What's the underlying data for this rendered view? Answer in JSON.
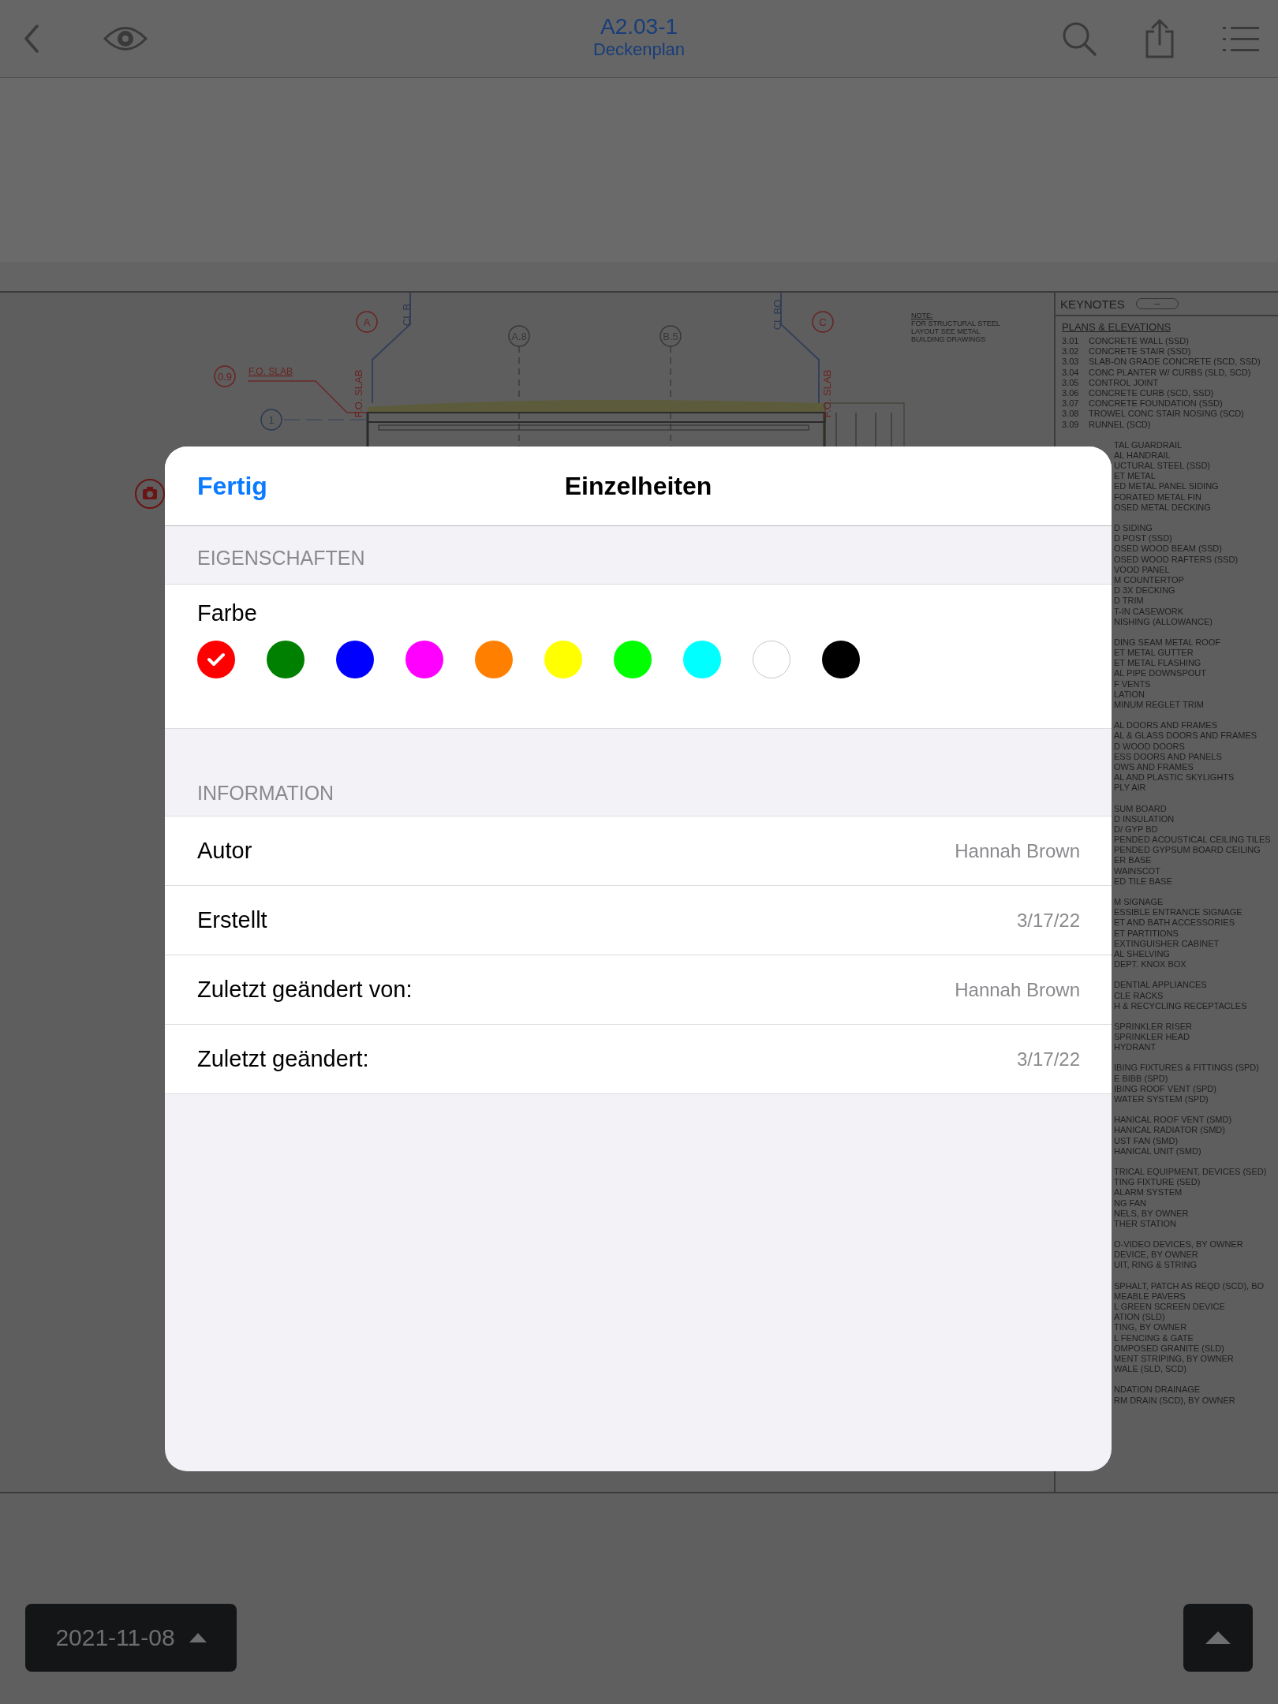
{
  "nav": {
    "title": "A2.03-1",
    "subtitle": "Deckenplan"
  },
  "drawing": {
    "bubbles": [
      "A",
      "A.8",
      "B.5",
      "C",
      "0.9",
      "1"
    ],
    "vertical_labels": [
      "CL B",
      "CL BO",
      "F.O. SLAB",
      "F.O. SLAB"
    ],
    "slab_label": "F.O. SLAB",
    "note": [
      "NOTE:",
      "FOR STRUCTURAL STEEL",
      "LAYOUT SEE METAL",
      "BUILDING DRAWINGS"
    ]
  },
  "keynotes": {
    "title": "KEYNOTES",
    "section": "PLANS & ELEVATIONS",
    "items": [
      {
        "number": "3.01",
        "text": "CONCRETE WALL (SSD)"
      },
      {
        "number": "3.02",
        "text": "CONCRETE STAIR (SSD)"
      },
      {
        "number": "3.03",
        "text": "SLAB-ON GRADE CONCRETE (SCD, SSD)"
      },
      {
        "number": "3.04",
        "text": "CONC PLANTER W/ CURBS (SLD, SCD)"
      },
      {
        "number": "3.05",
        "text": "CONTROL JOINT"
      },
      {
        "number": "3.06",
        "text": "CONCRETE CURB (SCD, SSD)"
      },
      {
        "number": "3.07",
        "text": "CONCRETE FOUNDATION (SSD)"
      },
      {
        "number": "3.08",
        "text": "TROWEL CONC STAIR NOSING (SCD)"
      },
      {
        "number": "3.09",
        "text": "RUNNEL (SCD)"
      }
    ],
    "covered_groups": [
      [
        "TAL GUARDRAIL",
        "AL HANDRAIL",
        "UCTURAL STEEL (SSD)",
        "ET METAL",
        "ED METAL PANEL SIDING",
        "FORATED METAL FIN",
        "OSED METAL DECKING"
      ],
      [
        "D SIDING",
        "D POST (SSD)",
        "OSED WOOD BEAM (SSD)",
        "OSED WOOD RAFTERS (SSD)",
        "VOOD PANEL",
        "M COUNTERTOP",
        "D 3X DECKING",
        "D TRIM",
        "T-IN CASEWORK",
        "NISHING (ALLOWANCE)"
      ],
      [
        "DING SEAM METAL ROOF",
        "ET METAL GUTTER",
        "ET METAL FLASHING",
        "AL PIPE DOWNSPOUT",
        "F VENTS",
        "LATION",
        "MINUM REGLET TRIM"
      ],
      [
        "AL DOORS AND FRAMES",
        "AL & GLASS DOORS AND FRAMES",
        "D WOOD DOORS",
        "ESS DOORS AND PANELS",
        "OWS AND FRAMES",
        "AL AND PLASTIC SKYLIGHTS",
        "PLY AIR"
      ],
      [
        "SUM BOARD",
        "D INSULATION",
        "D/ GYP BD",
        "PENDED ACOUSTICAL CEILING TILES",
        "PENDED GYPSUM BOARD CEILING",
        "ER BASE",
        "WAINSCOT",
        "ED TILE BASE"
      ],
      [
        "M SIGNAGE",
        "ESSIBLE ENTRANCE SIGNAGE",
        "ET AND BATH ACCESSORIES",
        "ET PARTITIONS",
        "EXTINGUISHER CABINET",
        "AL SHELVING",
        "DEPT. KNOX BOX"
      ],
      [
        "DENTIAL APPLIANCES",
        "CLE RACKS",
        "H & RECYCLING RECEPTACLES"
      ],
      [
        "SPRINKLER RISER",
        "SPRINKLER HEAD",
        "HYDRANT"
      ],
      [
        "IBING FIXTURES & FITTINGS (SPD)",
        "E BIBB (SPD)",
        "IBING ROOF VENT (SPD)",
        "WATER SYSTEM (SPD)"
      ],
      [
        "HANICAL ROOF VENT (SMD)",
        "HANICAL RADIATOR (SMD)",
        "UST FAN (SMD)",
        "HANICAL UNIT (SMD)"
      ],
      [
        "TRICAL EQUIPMENT, DEVICES (SED)",
        "TING FIXTURE (SED)",
        "ALARM SYSTEM",
        "NG FAN",
        "NELS, BY OWNER",
        "THER STATION"
      ],
      [
        "O-VIDEO DEVICES, BY OWNER",
        "DEVICE, BY OWNER",
        "UIT, RING & STRING"
      ],
      [
        "SPHALT, PATCH AS REQD (SCD), BO",
        "MEABLE PAVERS",
        "L GREEN SCREEN DEVICE",
        "ATION (SLD)",
        "TING, BY OWNER",
        "L FENCING & GATE",
        "OMPOSED GRANITE (SLD)",
        "MENT STRIPING, BY OWNER",
        "WALE (SLD, SCD)"
      ],
      [
        "NDATION DRAINAGE",
        "RM DRAIN (SCD), BY OWNER"
      ]
    ]
  },
  "sheet": {
    "done": "Fertig",
    "title": "Einzelheiten",
    "properties_header": "EIGENSCHAFTEN",
    "color_label": "Farbe",
    "colors": [
      {
        "color": "#ff0000",
        "selected": true
      },
      {
        "color": "#008000",
        "selected": false
      },
      {
        "color": "#0000ff",
        "selected": false
      },
      {
        "color": "#ff00ff",
        "selected": false
      },
      {
        "color": "#ff8000",
        "selected": false
      },
      {
        "color": "#ffff00",
        "selected": false
      },
      {
        "color": "#00ff00",
        "selected": false
      },
      {
        "color": "#00ffff",
        "selected": false
      },
      {
        "color": "#ffffff",
        "selected": false
      },
      {
        "color": "#000000",
        "selected": false
      }
    ],
    "info_header": "INFORMATION",
    "info": [
      {
        "label": "Autor",
        "value": "Hannah Brown"
      },
      {
        "label": "Erstellt",
        "value": "3/17/22"
      },
      {
        "label": "Zuletzt geändert von:",
        "value": "Hannah Brown"
      },
      {
        "label": "Zuletzt geändert:",
        "value": "3/17/22"
      }
    ]
  },
  "bottom": {
    "date": "2021-11-08"
  }
}
